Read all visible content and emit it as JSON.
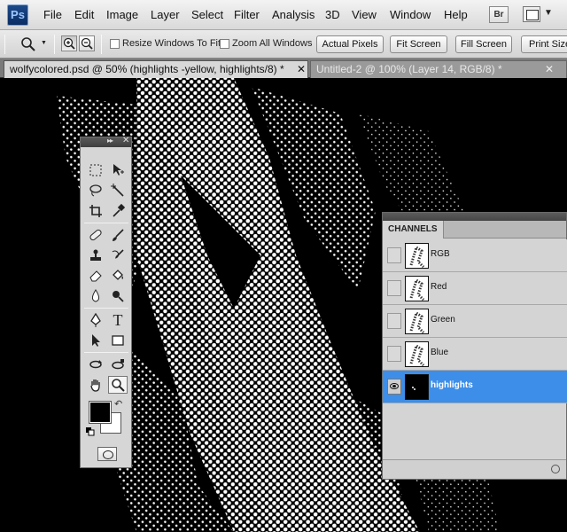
{
  "app": {
    "logo": "Ps"
  },
  "menu": [
    "File",
    "Edit",
    "Image",
    "Layer",
    "Select",
    "Filter",
    "Analysis",
    "3D",
    "View",
    "Window",
    "Help"
  ],
  "menubar_right": {
    "bridge_label": "Br",
    "screen_mode_icon": "screen-mode-icon"
  },
  "options": {
    "resize_windows": {
      "label": "Resize Windows To Fit",
      "checked": false
    },
    "zoom_all": {
      "label": "Zoom All Windows",
      "checked": false
    },
    "buttons": [
      "Actual Pixels",
      "Fit Screen",
      "Fill Screen",
      "Print Size"
    ]
  },
  "tabs": [
    {
      "title": "wolfycolored.psd @ 50% (highlights -yellow, highlights/8) *",
      "active": true
    },
    {
      "title": "Untitled-2 @ 100% (Layer 14, RGB/8) *",
      "active": false
    }
  ],
  "toolbox": {
    "tools": [
      "marquee-tool",
      "move-tool",
      "lasso-tool",
      "magic-wand-tool",
      "crop-tool",
      "eyedropper-tool",
      "spot-healing-tool",
      "brush-tool",
      "clone-stamp-tool",
      "history-brush-tool",
      "eraser-tool",
      "paint-bucket-tool",
      "blur-tool",
      "dodge-tool",
      "pen-tool",
      "type-tool",
      "path-selection-tool",
      "shape-tool",
      "3d-rotate-tool",
      "3d-orbit-tool",
      "hand-tool",
      "zoom-tool"
    ],
    "selected_tool": "zoom-tool",
    "foreground_color": "#000000",
    "background_color": "#ffffff"
  },
  "channels": {
    "panel_title": "CHANNELS",
    "items": [
      {
        "name": "RGB",
        "visible": false,
        "selected": false
      },
      {
        "name": "Red",
        "visible": false,
        "selected": false
      },
      {
        "name": "Green",
        "visible": false,
        "selected": false
      },
      {
        "name": "Blue",
        "visible": false,
        "selected": false
      },
      {
        "name": "highlights",
        "visible": true,
        "selected": true
      }
    ]
  },
  "colors": {
    "selection_blue": "#3d8ee8",
    "chrome": "#d6d6d6"
  }
}
